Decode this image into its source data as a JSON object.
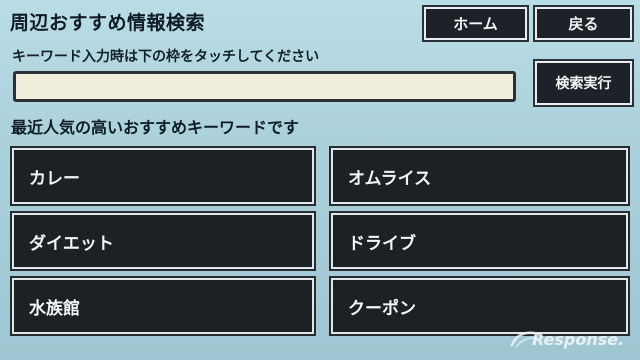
{
  "header": {
    "title": "周辺おすすめ情報検索",
    "home_label": "ホーム",
    "back_label": "戻る"
  },
  "search": {
    "instruction": "キーワード入力時は下の枠をタッチしてください",
    "value": "",
    "placeholder": "",
    "execute_label": "検索実行"
  },
  "recommendations": {
    "heading": "最近人気の高いおすすめキーワードです",
    "keywords": [
      "カレー",
      "オムライス",
      "ダイエット",
      "ドライブ",
      "水族館",
      "クーポン"
    ]
  },
  "watermark": {
    "text": "Response."
  },
  "colors": {
    "background": "#a9cfda",
    "button": "#1c2126",
    "button_text": "#f3f5f6",
    "input_bg": "#f1eedc"
  }
}
